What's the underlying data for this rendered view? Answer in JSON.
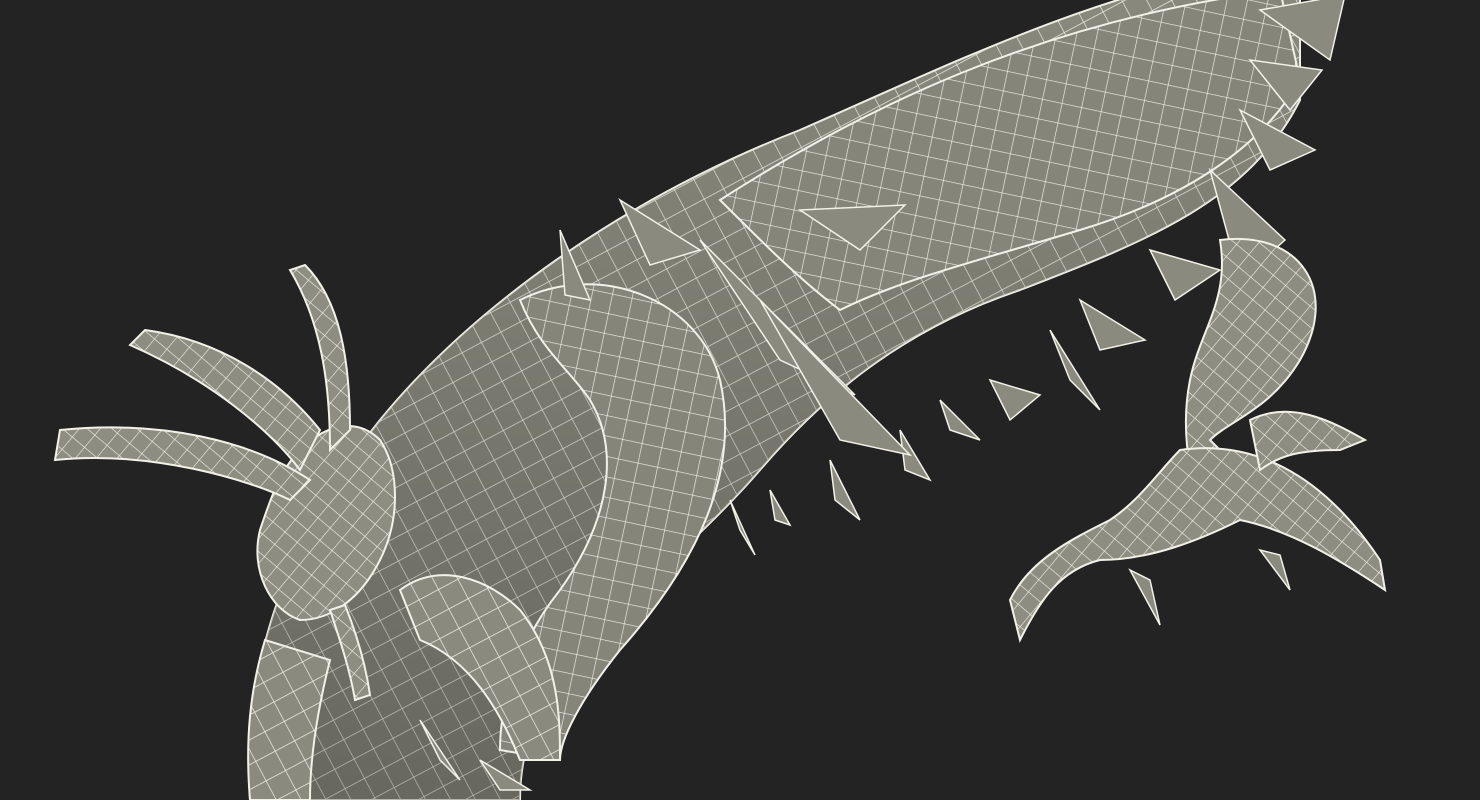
{
  "scene": {
    "subject": "wireframe-dragon-model",
    "background_color": "#232323",
    "surface_color": "#8b8b7f",
    "wire_color": "#f2f1e8"
  }
}
